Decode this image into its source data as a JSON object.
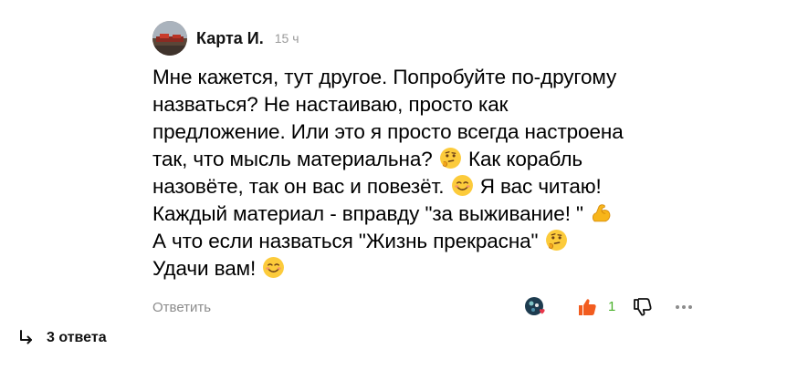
{
  "comment": {
    "author": "Карта И.",
    "time": "15 ч",
    "lines": [
      "Мне кажется, тут другое. Попробуйте по-другому",
      "назваться? Не настаиваю, просто как",
      "предложение. Или это я просто всегда настроена",
      "так, что мысль материальна? ",
      " Как корабль",
      "назовёте, так он вас и повезёт. ",
      " Я вас читаю!",
      "Каждый материал - вправду \"за выживание! \" ",
      "А что если назваться \"Жизнь прекрасна\" ",
      "Удачи вам! "
    ],
    "emojis": [
      "thinking-face",
      "smiling-face",
      "flexed-biceps",
      "thinking-face",
      "smiling-face"
    ]
  },
  "actions": {
    "reply_label": "Ответить",
    "like_count": "1",
    "like_color": "#f25c1f",
    "count_color": "#4ab12a"
  },
  "replies": {
    "label": "3 ответа"
  }
}
